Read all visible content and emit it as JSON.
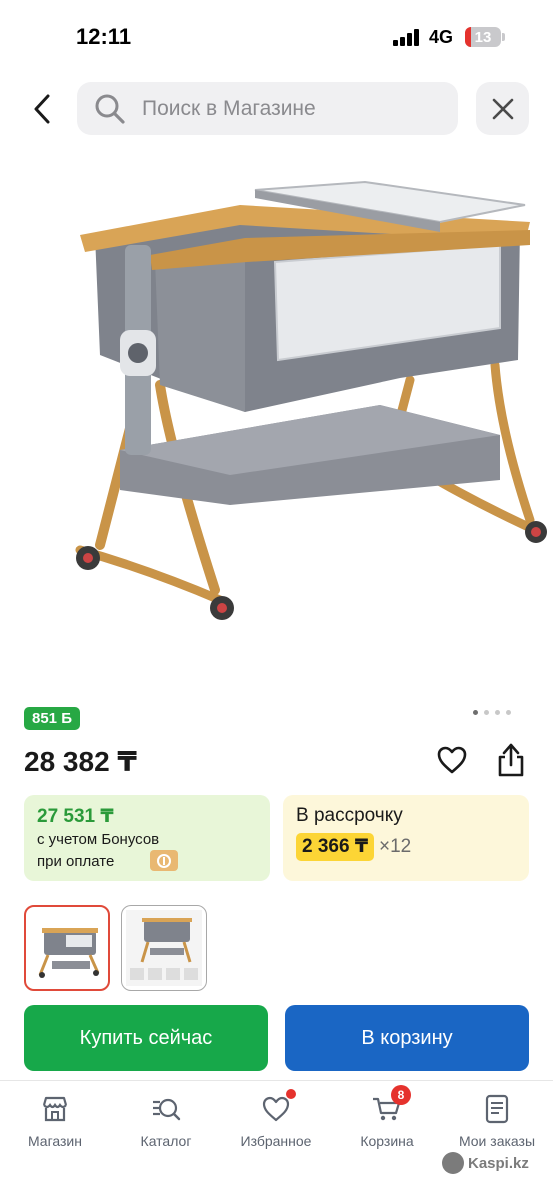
{
  "status_bar": {
    "time": "12:11",
    "network": "4G",
    "battery": "13"
  },
  "header": {
    "search_placeholder": "Поиск в Магазине"
  },
  "product": {
    "bonus_badge": "851 Б",
    "price": "28 382 ₸",
    "image_dots": 4,
    "active_dot": 0
  },
  "bonus_card": {
    "price": "27 531 ₸",
    "line1": "с учетом Бонусов",
    "line2": "при оплате"
  },
  "credit_card": {
    "title": "В рассрочку",
    "monthly": "2 366 ₸",
    "multiplier": "×12"
  },
  "actions": {
    "buy_now": "Купить сейчас",
    "add_to_cart": "В корзину"
  },
  "tabbar": {
    "items": [
      {
        "label": "Магазин"
      },
      {
        "label": "Каталог"
      },
      {
        "label": "Избранное"
      },
      {
        "label": "Корзина",
        "badge": "8"
      },
      {
        "label": "Мои заказы"
      }
    ]
  },
  "watermark": "Kaspi.kz",
  "colors": {
    "green": "#17a84a",
    "blue": "#1a66c4",
    "yellow": "#fcd535",
    "red": "#e5322d"
  }
}
